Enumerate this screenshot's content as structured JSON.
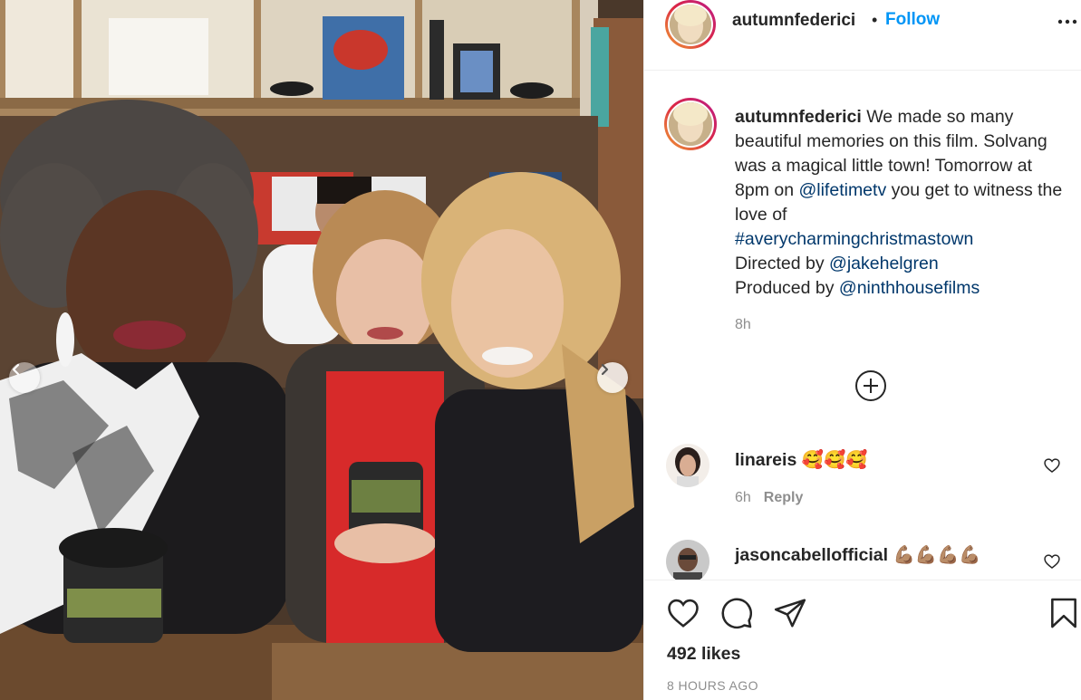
{
  "post": {
    "username": "autumnfederici",
    "follow_label": "Follow",
    "separator": "•",
    "caption": {
      "username": "autumnfederici",
      "line1": "We made so many beautiful memories on this film. Solvang was a magical little town! Tomorrow at 8pm on ",
      "mention1": "@lifetimetv",
      "line2": " you get to witness the love of ",
      "hashtag": "#averycharmingchristmastown",
      "directed_prefix": "Directed by ",
      "mention2": "@jakehelgren",
      "produced_prefix": "Produced by ",
      "mention3": "@ninthhousefilms",
      "time": "8h"
    },
    "likes": "492 likes",
    "time_ago": "8 HOURS AGO"
  },
  "comments": [
    {
      "username": "linareis",
      "emoji": "🥰🥰🥰",
      "time": "6h",
      "reply_label": "Reply"
    },
    {
      "username": "jasoncabellofficial",
      "emoji": "💪🏽💪🏽💪🏽💪🏽"
    }
  ],
  "icons": {
    "more": "more-options-icon",
    "load_more": "plus-circle-icon",
    "like": "heart-icon",
    "comment": "comment-icon",
    "share": "share-icon",
    "save": "bookmark-icon",
    "carousel_prev": "chevron-left-icon",
    "carousel_next": "chevron-right-icon"
  },
  "colors": {
    "follow": "#0095f6",
    "link": "#00376b",
    "muted": "#8e8e8e"
  }
}
